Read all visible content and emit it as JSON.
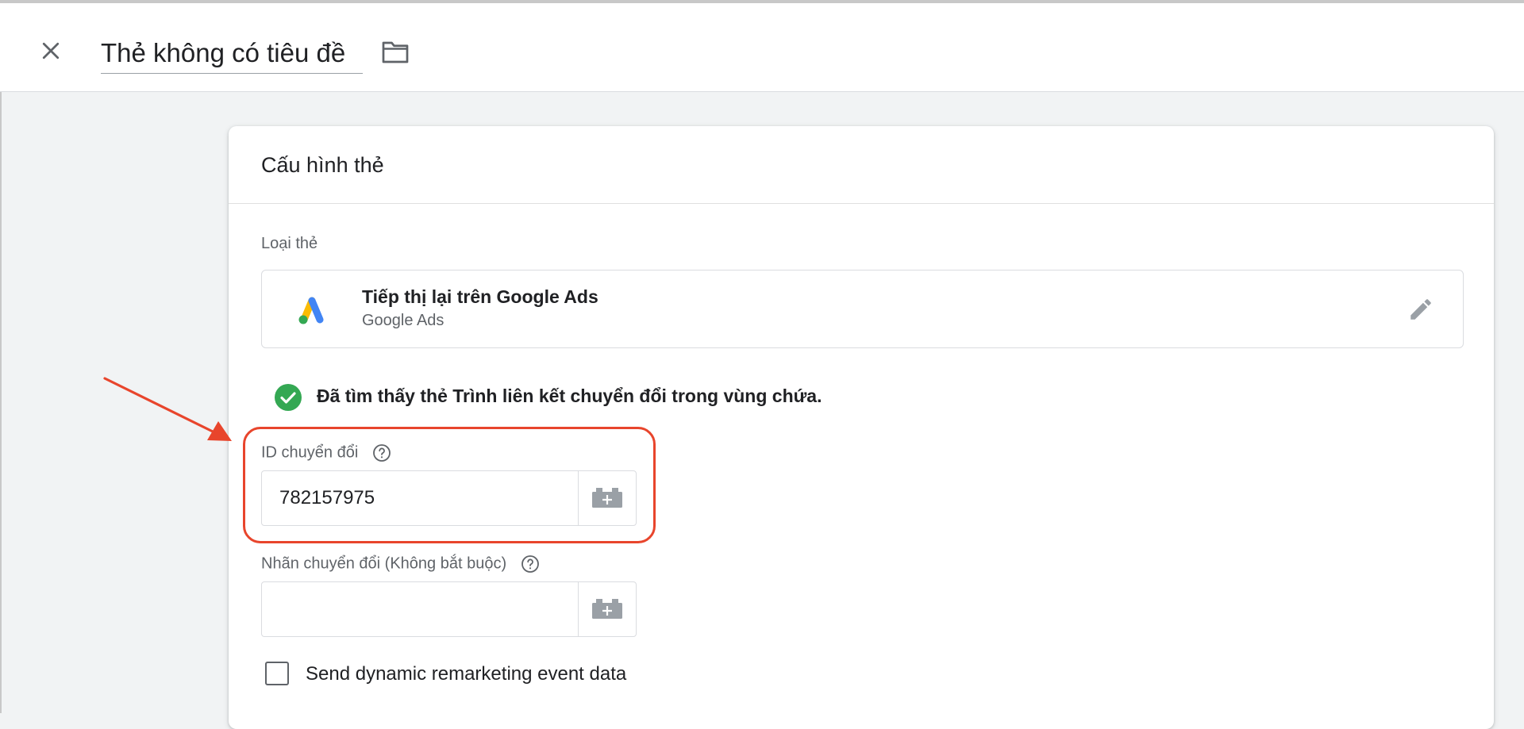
{
  "header": {
    "title": "Thẻ không có tiêu đề",
    "close_icon": "close-icon",
    "folder_icon": "folder-icon"
  },
  "card": {
    "title": "Cấu hình thẻ",
    "tag_type": {
      "label": "Loại thẻ",
      "name": "Tiếp thị lại trên Google Ads",
      "subtitle": "Google Ads",
      "logo": "google-ads-logo",
      "edit_icon": "pencil-icon"
    },
    "notice": {
      "icon": "check-circle-icon",
      "text": "Đã tìm thấy thẻ Trình liên kết chuyển đổi trong vùng chứa."
    },
    "conversion_id": {
      "label": "ID chuyển đổi",
      "value": "782157975",
      "variable_icon": "variable-picker-icon"
    },
    "conversion_label": {
      "label": "Nhãn chuyển đổi (Không bắt buộc)",
      "value": "",
      "variable_icon": "variable-picker-icon"
    },
    "dynamic_remarketing": {
      "label": "Send dynamic remarketing event data",
      "checked": false
    }
  },
  "annotation": {
    "color": "#e8452c"
  },
  "colors": {
    "background": "#f1f3f4",
    "success": "#34a853",
    "ads_blue": "#4285f4",
    "ads_yellow": "#fbbc04",
    "ads_green": "#34a853"
  }
}
